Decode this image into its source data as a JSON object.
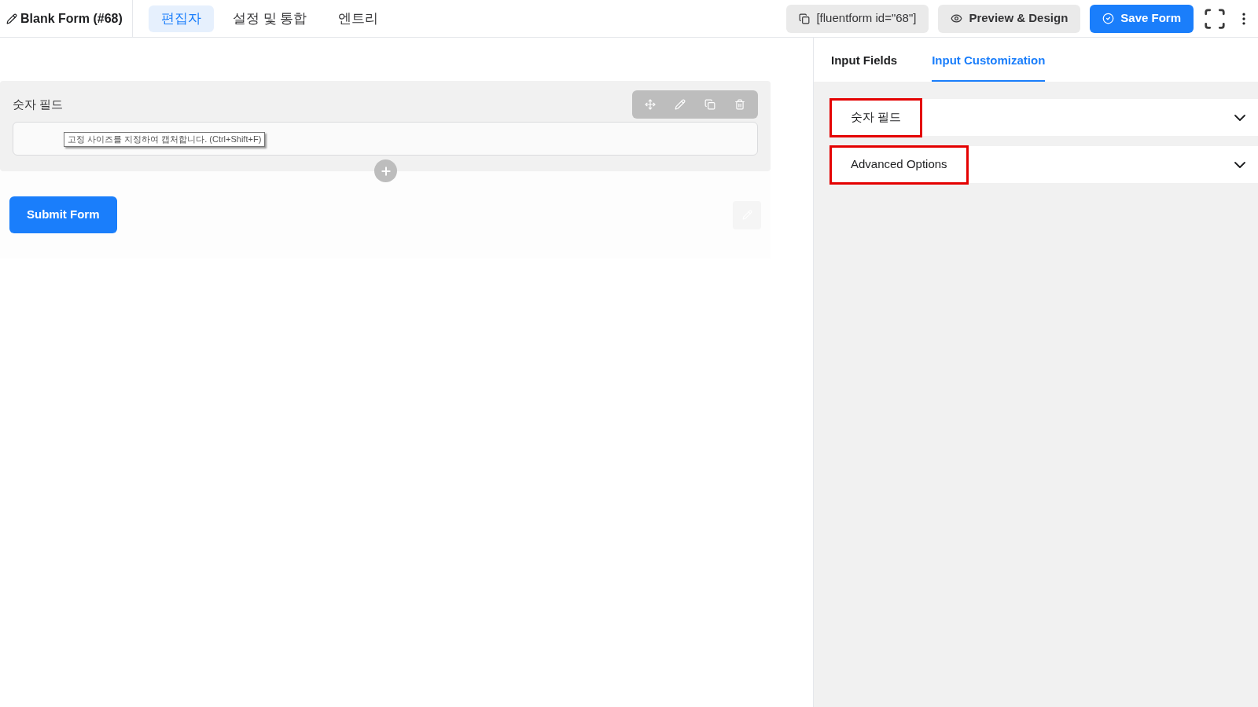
{
  "header": {
    "title": "Blank Form (#68)",
    "tabs": [
      {
        "label": "편집자",
        "selected": true
      },
      {
        "label": "설정 및 통합",
        "selected": false
      },
      {
        "label": "엔트리",
        "selected": false
      }
    ],
    "shortcode": "[fluentform id=\"68\"]",
    "preview_button": "Preview & Design",
    "save_button": "Save Form"
  },
  "editor": {
    "field": {
      "label": "숫자 필드",
      "tooltip": "고정 사이즈를 지정하여 캡처합니다. (Ctrl+Shift+F)"
    },
    "submit_button": "Submit Form"
  },
  "sidebar": {
    "tabs": [
      {
        "label": "Input Fields",
        "selected": false
      },
      {
        "label": "Input Customization",
        "selected": true
      }
    ],
    "sections": [
      {
        "title": "숫자 필드",
        "expanded": false,
        "highlighted": true
      },
      {
        "title": "Advanced Options",
        "expanded": false,
        "highlighted": true
      }
    ]
  }
}
